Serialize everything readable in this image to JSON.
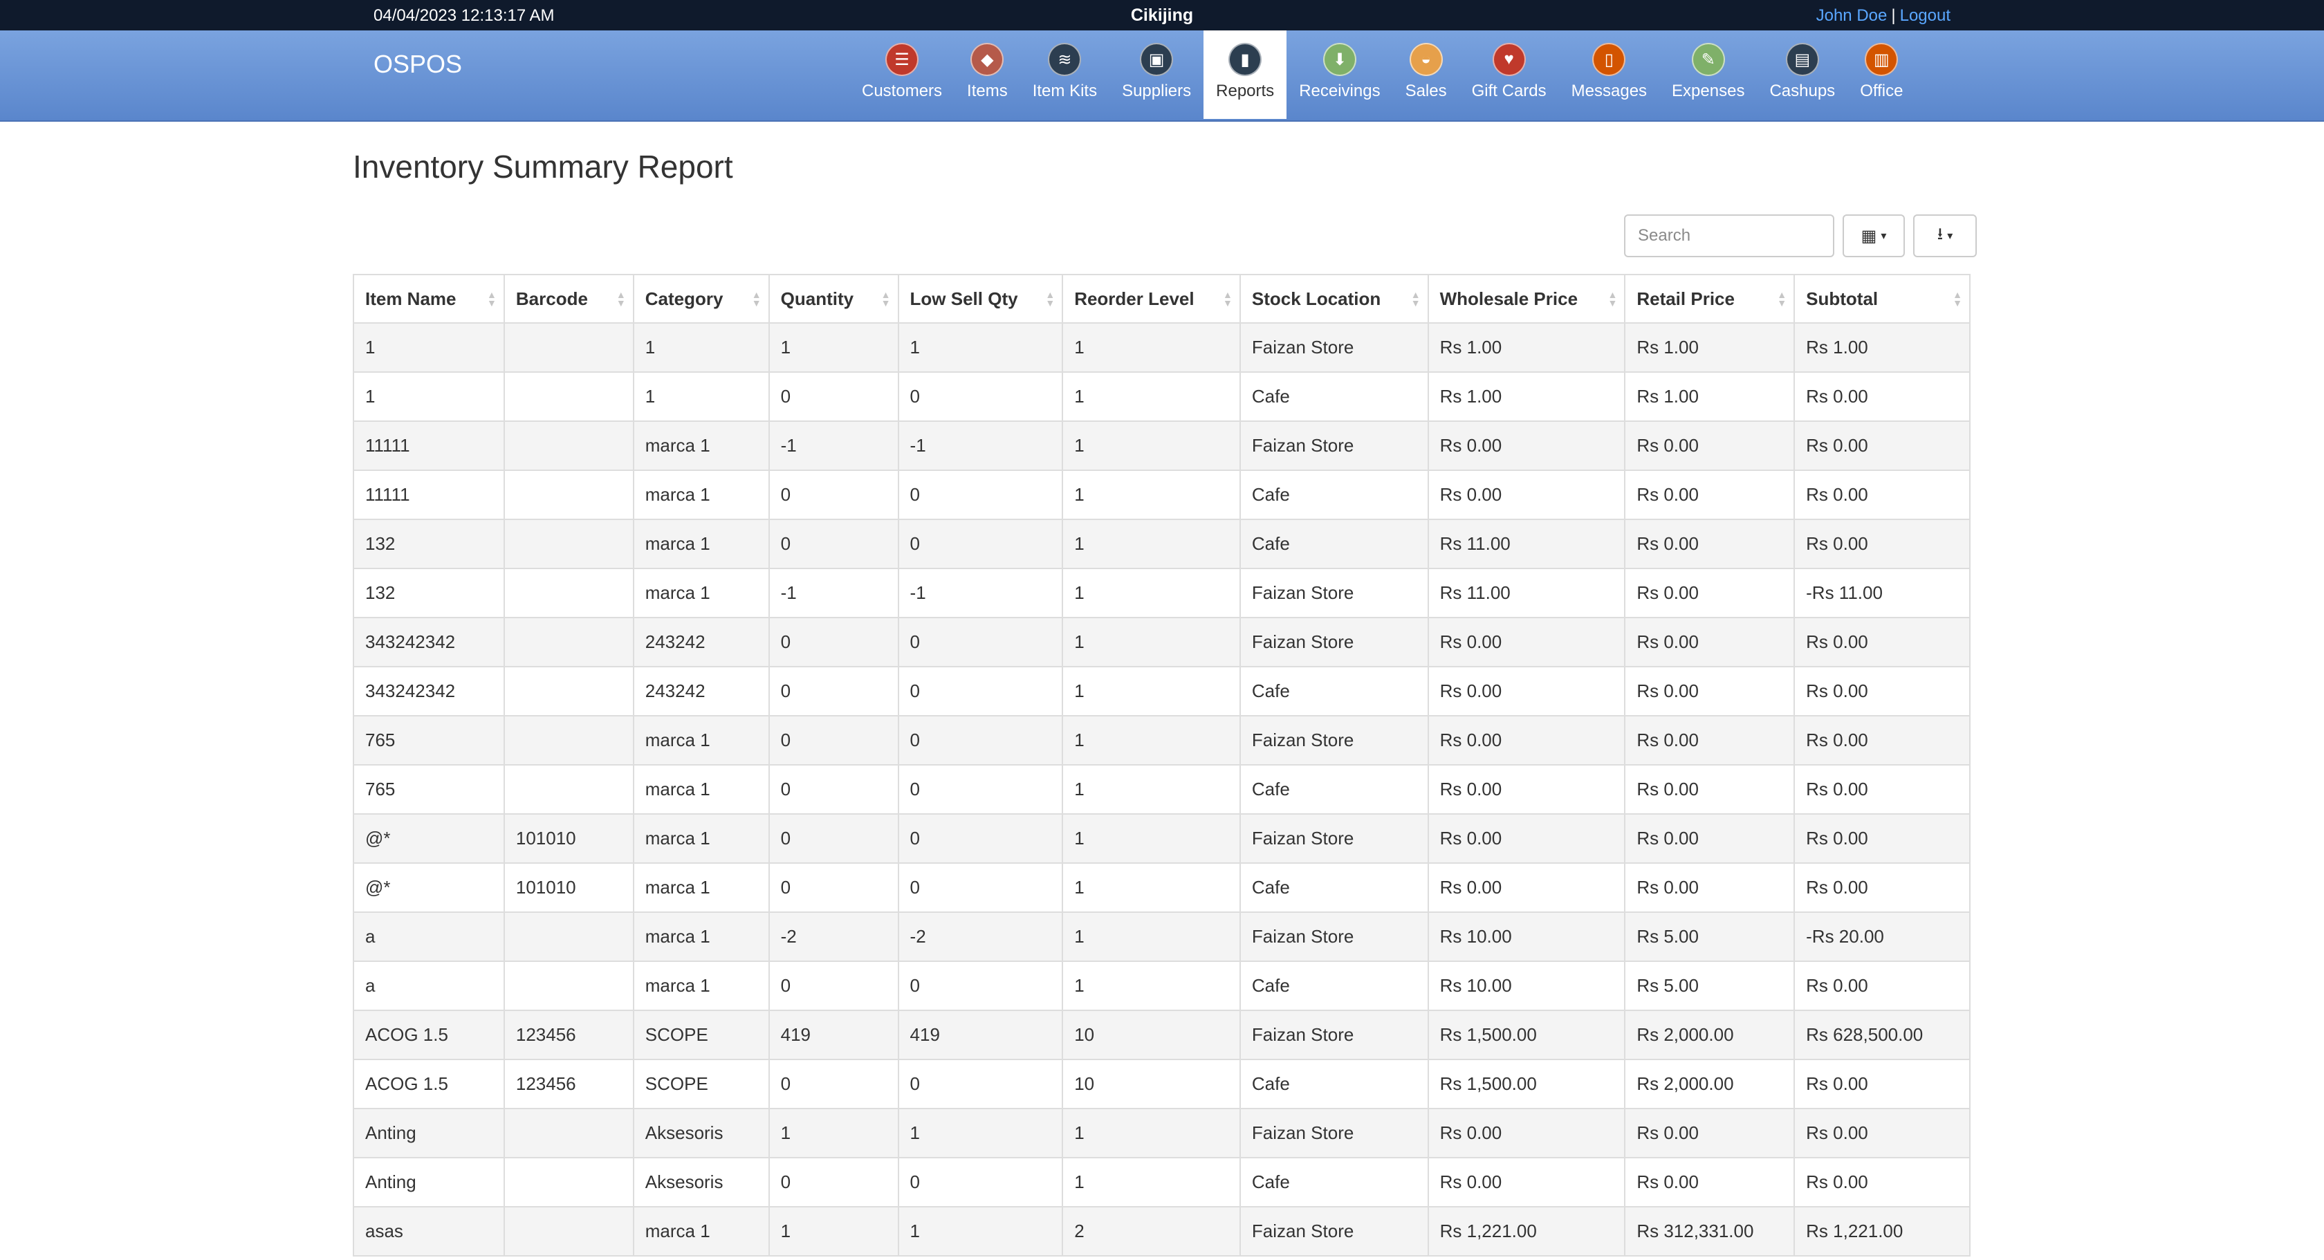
{
  "topbar": {
    "datetime": "04/04/2023 12:13:17 AM",
    "company": "Cikijing",
    "user": "John Doe",
    "separator": "|",
    "logout": "Logout"
  },
  "brand": "OSPOS",
  "nav": [
    {
      "label": "Customers",
      "icon": "customers-icon",
      "color": "#c0392b"
    },
    {
      "label": "Items",
      "icon": "items-icon",
      "color": "#b55a4a"
    },
    {
      "label": "Item Kits",
      "icon": "item-kits-icon",
      "color": "#2c3e50"
    },
    {
      "label": "Suppliers",
      "icon": "suppliers-icon",
      "color": "#2c3e50"
    },
    {
      "label": "Reports",
      "icon": "reports-icon",
      "color": "#2c3e50",
      "active": true
    },
    {
      "label": "Receivings",
      "icon": "receivings-icon",
      "color": "#7fb069"
    },
    {
      "label": "Sales",
      "icon": "sales-icon",
      "color": "#e6a04b"
    },
    {
      "label": "Gift Cards",
      "icon": "gift-cards-icon",
      "color": "#c0392b"
    },
    {
      "label": "Messages",
      "icon": "messages-icon",
      "color": "#d35400"
    },
    {
      "label": "Expenses",
      "icon": "expenses-icon",
      "color": "#7fb069"
    },
    {
      "label": "Cashups",
      "icon": "cashups-icon",
      "color": "#2c3e50"
    },
    {
      "label": "Office",
      "icon": "office-icon",
      "color": "#d35400"
    }
  ],
  "page_title": "Inventory Summary Report",
  "search": {
    "placeholder": "Search"
  },
  "columns": [
    "Item Name",
    "Barcode",
    "Category",
    "Quantity",
    "Low Sell Qty",
    "Reorder Level",
    "Stock Location",
    "Wholesale Price",
    "Retail Price",
    "Subtotal"
  ],
  "rows": [
    [
      "1",
      "",
      "1",
      "1",
      "1",
      "1",
      "Faizan Store",
      "Rs 1.00",
      "Rs 1.00",
      "Rs 1.00"
    ],
    [
      "1",
      "",
      "1",
      "0",
      "0",
      "1",
      "Cafe",
      "Rs 1.00",
      "Rs 1.00",
      "Rs 0.00"
    ],
    [
      "11111",
      "",
      "marca 1",
      "-1",
      "-1",
      "1",
      "Faizan Store",
      "Rs 0.00",
      "Rs 0.00",
      "Rs 0.00"
    ],
    [
      "11111",
      "",
      "marca 1",
      "0",
      "0",
      "1",
      "Cafe",
      "Rs 0.00",
      "Rs 0.00",
      "Rs 0.00"
    ],
    [
      "132",
      "",
      "marca 1",
      "0",
      "0",
      "1",
      "Cafe",
      "Rs 11.00",
      "Rs 0.00",
      "Rs 0.00"
    ],
    [
      "132",
      "",
      "marca 1",
      "-1",
      "-1",
      "1",
      "Faizan Store",
      "Rs 11.00",
      "Rs 0.00",
      "-Rs 11.00"
    ],
    [
      "343242342",
      "",
      "243242",
      "0",
      "0",
      "1",
      "Faizan Store",
      "Rs 0.00",
      "Rs 0.00",
      "Rs 0.00"
    ],
    [
      "343242342",
      "",
      "243242",
      "0",
      "0",
      "1",
      "Cafe",
      "Rs 0.00",
      "Rs 0.00",
      "Rs 0.00"
    ],
    [
      "765",
      "",
      "marca 1",
      "0",
      "0",
      "1",
      "Faizan Store",
      "Rs 0.00",
      "Rs 0.00",
      "Rs 0.00"
    ],
    [
      "765",
      "",
      "marca 1",
      "0",
      "0",
      "1",
      "Cafe",
      "Rs 0.00",
      "Rs 0.00",
      "Rs 0.00"
    ],
    [
      "@*",
      "101010",
      "marca 1",
      "0",
      "0",
      "1",
      "Faizan Store",
      "Rs 0.00",
      "Rs 0.00",
      "Rs 0.00"
    ],
    [
      "@*",
      "101010",
      "marca 1",
      "0",
      "0",
      "1",
      "Cafe",
      "Rs 0.00",
      "Rs 0.00",
      "Rs 0.00"
    ],
    [
      "a",
      "",
      "marca 1",
      "-2",
      "-2",
      "1",
      "Faizan Store",
      "Rs 10.00",
      "Rs 5.00",
      "-Rs 20.00"
    ],
    [
      "a",
      "",
      "marca 1",
      "0",
      "0",
      "1",
      "Cafe",
      "Rs 10.00",
      "Rs 5.00",
      "Rs 0.00"
    ],
    [
      "ACOG 1.5",
      "123456",
      "SCOPE",
      "419",
      "419",
      "10",
      "Faizan Store",
      "Rs 1,500.00",
      "Rs 2,000.00",
      "Rs 628,500.00"
    ],
    [
      "ACOG 1.5",
      "123456",
      "SCOPE",
      "0",
      "0",
      "10",
      "Cafe",
      "Rs 1,500.00",
      "Rs 2,000.00",
      "Rs 0.00"
    ],
    [
      "Anting",
      "",
      "Aksesoris",
      "1",
      "1",
      "1",
      "Faizan Store",
      "Rs 0.00",
      "Rs 0.00",
      "Rs 0.00"
    ],
    [
      "Anting",
      "",
      "Aksesoris",
      "0",
      "0",
      "1",
      "Cafe",
      "Rs 0.00",
      "Rs 0.00",
      "Rs 0.00"
    ],
    [
      "asas",
      "",
      "marca 1",
      "1",
      "1",
      "2",
      "Faizan Store",
      "Rs 1,221.00",
      "Rs 312,331.00",
      "Rs 1,221.00"
    ]
  ]
}
